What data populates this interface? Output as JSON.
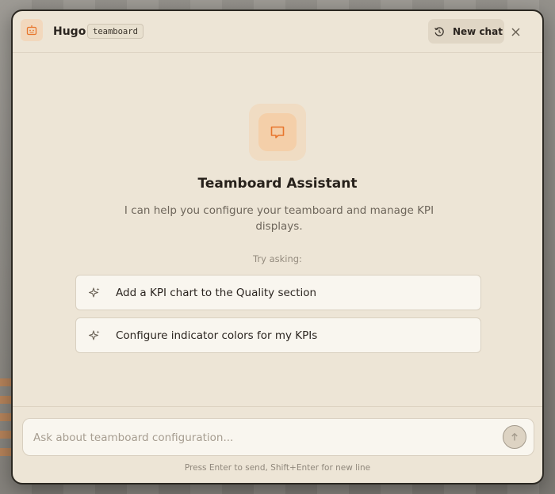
{
  "header": {
    "assistant_name": "Hugo",
    "tag": "teamboard",
    "new_chat_label": "New chat"
  },
  "main": {
    "heading": "Teamboard Assistant",
    "subtitle": "I can help you configure your teamboard and manage KPI displays.",
    "try_label": "Try asking:",
    "suggestions": [
      {
        "label": "Add a KPI chart to the Quality section",
        "icon": "sparkle-icon"
      },
      {
        "label": "Configure indicator colors for my KPIs",
        "icon": "sparkle-icon"
      }
    ]
  },
  "composer": {
    "placeholder": "Ask about teamboard configuration...",
    "hint": "Press Enter to send, Shift+Enter for new line"
  },
  "colors": {
    "accent": "#e8762d",
    "panel": "#ede5d6",
    "card": "#f9f6ef"
  },
  "icons": {
    "logo": "robot-icon",
    "new_chat": "history-icon",
    "close": "close-icon",
    "hero": "chat-bubble-icon",
    "send": "arrow-up-icon"
  }
}
